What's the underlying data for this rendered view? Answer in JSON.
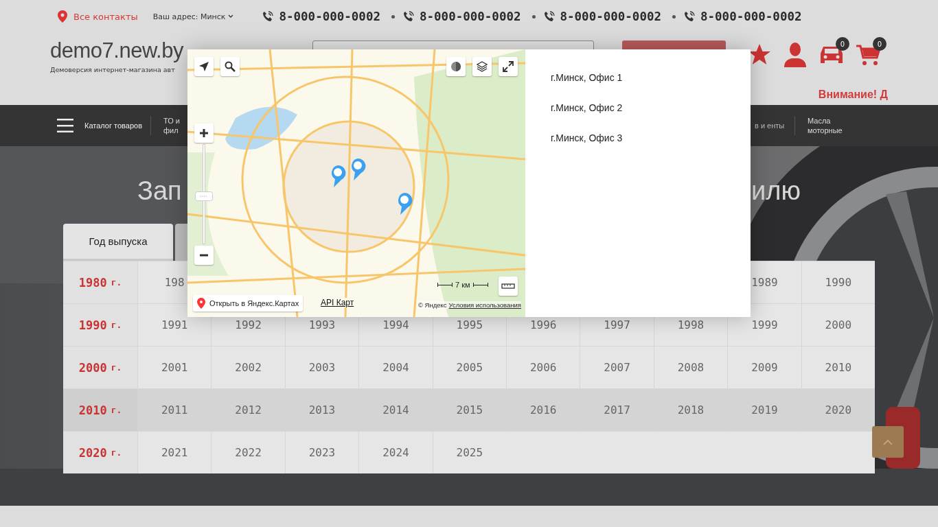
{
  "topbar": {
    "contacts_link": "Все контакты",
    "address": "Ваш адрес: Минск",
    "phones": [
      "8-000-000-0002",
      "8-000-000-0002",
      "8-000-000-0002",
      "8-000-000-0002"
    ]
  },
  "header": {
    "logo": "demo7.new.by",
    "tagline": "Демоверсия интернет-магазина авт",
    "garage_count": "0",
    "cart_count": "0",
    "notice": "Внимание! Д"
  },
  "nav": {
    "catalog": "Каталог товаров",
    "items": [
      "ТО и фил",
      "в и енты",
      "Масла моторные"
    ]
  },
  "hero": {
    "heading_start": "Зап",
    "heading_end": "илю",
    "tabs": [
      {
        "label": "Год выпуска",
        "selected": true
      },
      {
        "selected": false
      }
    ],
    "year_rows": [
      {
        "decade": "1980",
        "unit": "г.",
        "years_start": [
          "198"
        ],
        "years_end": [
          "1989",
          "1990"
        ]
      },
      {
        "decade": "1990",
        "unit": "г.",
        "years": [
          "1991",
          "1992",
          "1993",
          "1994",
          "1995",
          "1996",
          "1997",
          "1998",
          "1999",
          "2000"
        ]
      },
      {
        "decade": "2000",
        "unit": "г.",
        "years": [
          "2001",
          "2002",
          "2003",
          "2004",
          "2005",
          "2006",
          "2007",
          "2008",
          "2009",
          "2010"
        ]
      },
      {
        "decade": "2010",
        "unit": "г.",
        "years": [
          "2011",
          "2012",
          "2013",
          "2014",
          "2015",
          "2016",
          "2017",
          "2018",
          "2019",
          "2020"
        ]
      },
      {
        "decade": "2020",
        "unit": "г.",
        "years": [
          "2021",
          "2022",
          "2023",
          "2024",
          "2025"
        ]
      }
    ]
  },
  "modal": {
    "map": {
      "open_link": "Открыть в Яндекс.Картах",
      "api_link": "API Карт",
      "copyright": "© Яндекс",
      "terms_link": "Условия использования",
      "scale": "7 км",
      "markers": [
        {
          "kind": "pin"
        },
        {
          "kind": "pin"
        },
        {
          "kind": "pin"
        }
      ]
    },
    "offices": [
      "г.Минск, Офис 1",
      "г.Минск, Офис 2",
      "г.Минск, Офис 3"
    ]
  }
}
